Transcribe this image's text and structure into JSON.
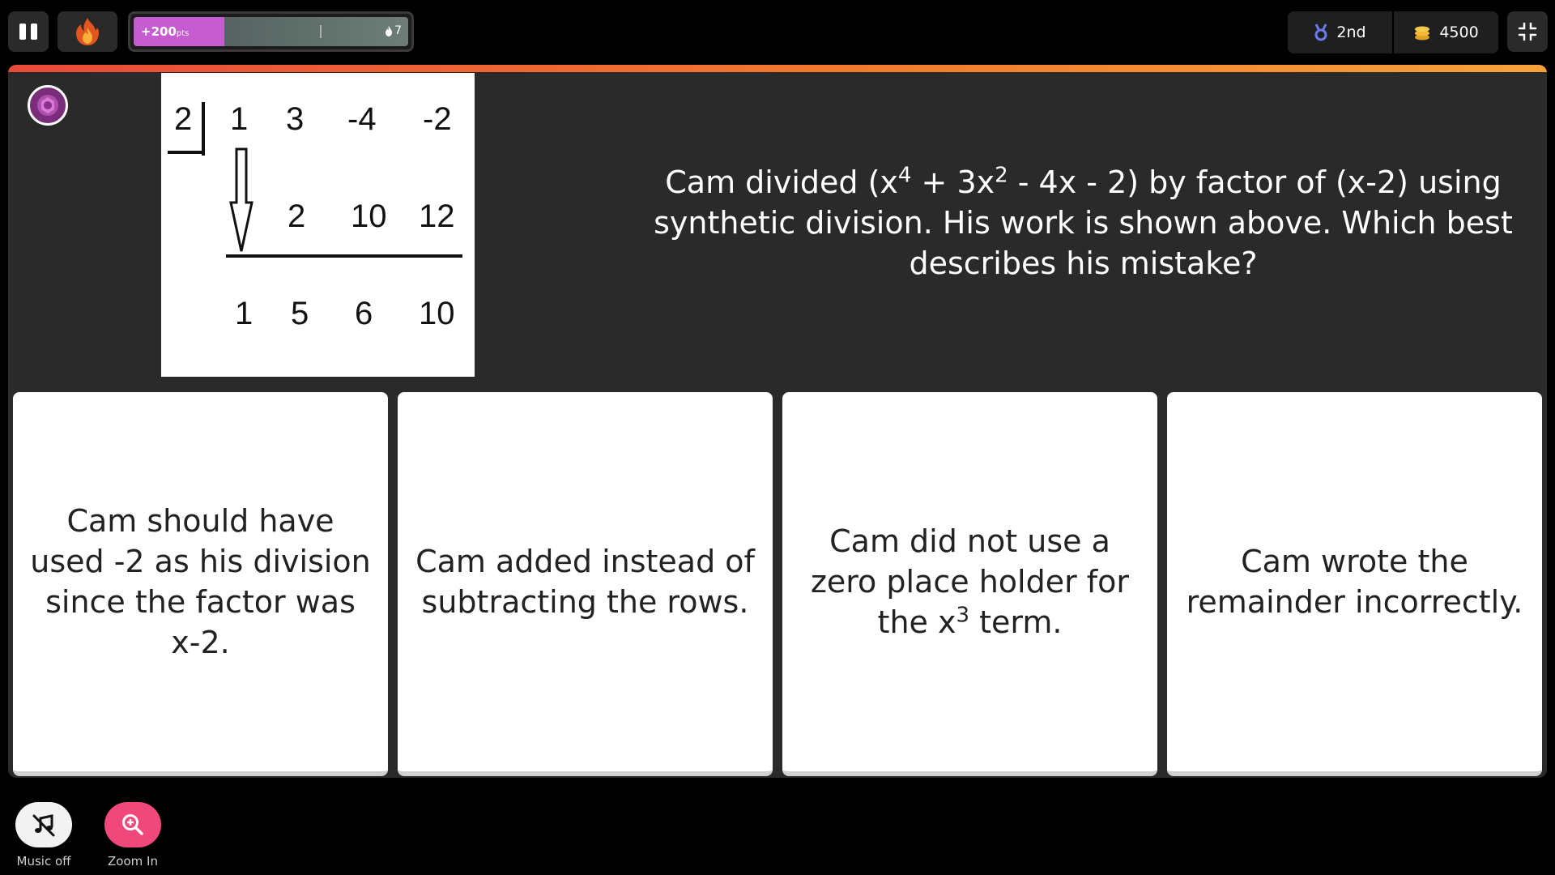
{
  "header": {
    "pause_icon": "pause-icon",
    "theme_icon": "flame-icon",
    "powerbar": {
      "points_value": "+200",
      "points_unit": "pts",
      "streak": "7",
      "fill_fraction": 0.33
    },
    "stats": {
      "rank": "2nd",
      "coins": "4500"
    },
    "collapse_icon": "collapse-icon"
  },
  "question": {
    "synthetic_division": {
      "divisor": "2",
      "row1": [
        "1",
        "3",
        "-4",
        "-2"
      ],
      "row2": [
        "2",
        "10",
        "12"
      ],
      "row3": [
        "1",
        "5",
        "6",
        "10"
      ]
    },
    "text_part1": "Cam divided (x",
    "exp1": "4",
    "text_part2": " + 3x",
    "exp2": "2",
    "text_part3": " - 4x - 2) by factor of (x-2) using synthetic division. His work is shown above. Which best describes his mistake?"
  },
  "answers": [
    {
      "text": "Cam should have used -2 as his division since the factor was x-2."
    },
    {
      "text": "Cam added instead of subtracting the rows."
    },
    {
      "text_before": "Cam did not use a zero place holder for the x",
      "exponent": "3",
      "text_after": " term."
    },
    {
      "text": "Cam wrote the remainder incorrectly."
    }
  ],
  "controls": {
    "music_label": "Music off",
    "zoom_label": "Zoom In"
  },
  "colors": {
    "powerbar_fill": "#c55ccf",
    "accent_start": "#e84a3a",
    "accent_end": "#f6a23a",
    "zoom_button": "#f0487a",
    "panel_bg": "#2a2a2a"
  }
}
